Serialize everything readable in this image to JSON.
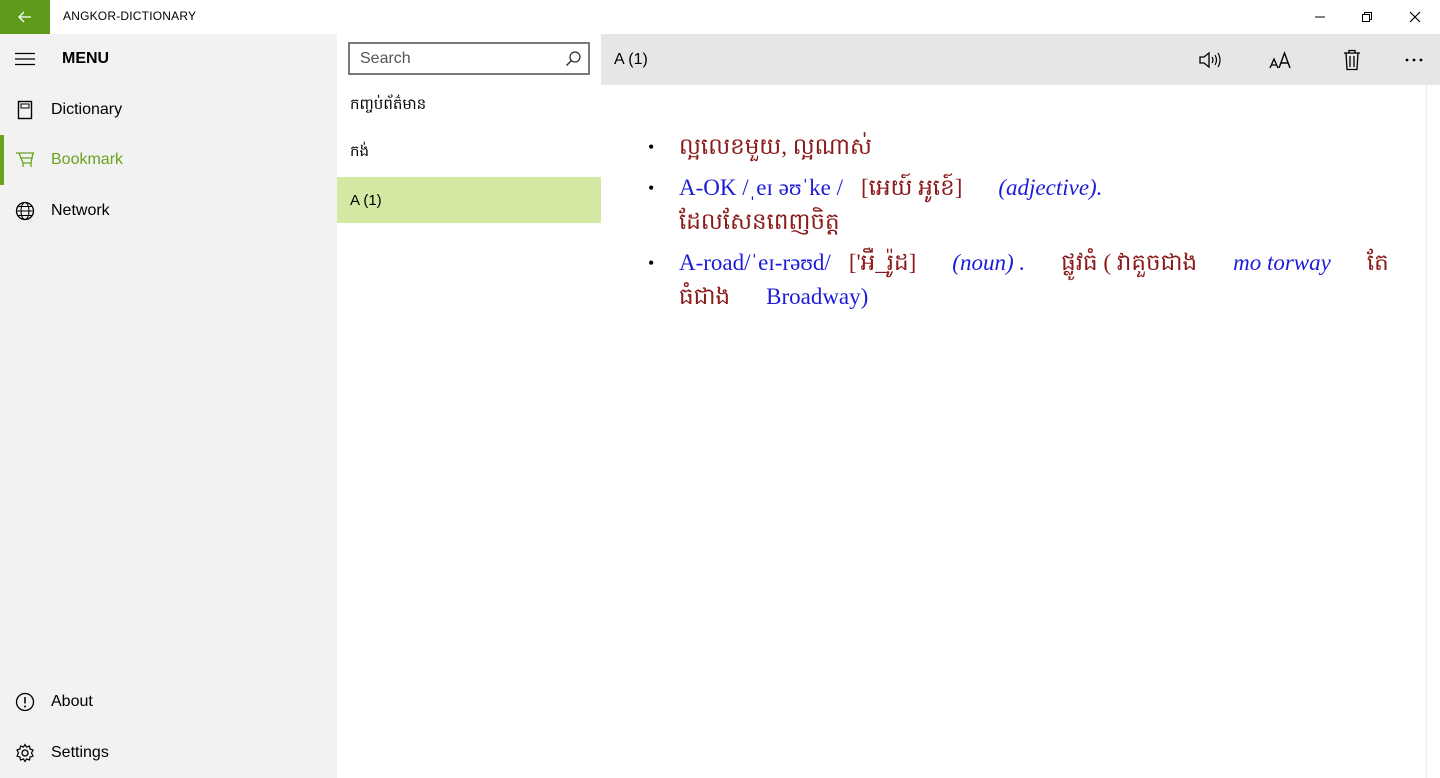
{
  "app": {
    "title": "ANGKOR-DICTIONARY"
  },
  "colors": {
    "accent": "#6aa31e",
    "back_button": "#5f9b1a",
    "selected_row": "#d4e8a3",
    "khmer_text": "#8b1a1a",
    "english_text": "#1c1cd6"
  },
  "nav": {
    "menu_label": "MENU",
    "items": [
      {
        "label": "Dictionary",
        "icon": "book-icon"
      },
      {
        "label": "Bookmark",
        "icon": "bookmark-icon",
        "selected": true
      },
      {
        "label": "Network",
        "icon": "globe-icon"
      }
    ],
    "bottom_items": [
      {
        "label": "About",
        "icon": "info-icon"
      },
      {
        "label": "Settings",
        "icon": "gear-icon"
      }
    ]
  },
  "word_list": {
    "search_placeholder": "Search",
    "items": [
      {
        "label": "កញ្ចប់ព័ត៌មាន"
      },
      {
        "label": "កង់"
      },
      {
        "label": "A (1)",
        "selected": true
      }
    ]
  },
  "entry": {
    "title": "A (1)",
    "definitions": [
      {
        "khmer_1": "ល្អលេខមួយ, ល្អណាស់"
      },
      {
        "headword": "A-OK /ˌeɪ əʊˈke /",
        "pronunciation": "[អេយ៍ អូខេ៍]",
        "pos": "(adjective).",
        "meaning": "ដែលសែនពេញចិត្ត"
      },
      {
        "headword": "A-road/ˈeɪ-rəʊd/",
        "pronunciation": "['អឺ_រ៉ូដ]",
        "pos": "(noun) .",
        "meaning": "ផ្លូវធំ ( វាគួចជាង",
        "example_1": "mo torway",
        "meaning_2": "តែធំជាង",
        "example_2": "Broadway)"
      }
    ]
  }
}
